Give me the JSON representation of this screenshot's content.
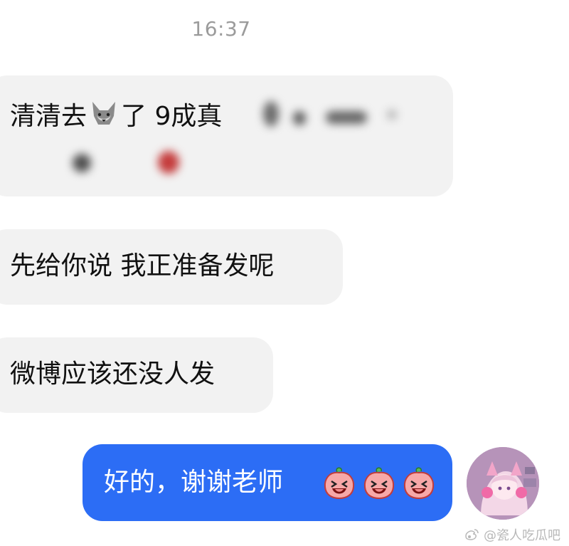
{
  "chat": {
    "timestamp": "16:37",
    "messages": [
      {
        "direction": "incoming",
        "text_before": "清清去",
        "icon": "wolf-icon",
        "text_after": "了 9成真"
      },
      {
        "direction": "incoming",
        "text": "先给你说 我正准备发呢"
      },
      {
        "direction": "incoming",
        "text": "微博应该还没人发"
      },
      {
        "direction": "outgoing",
        "text": "好的，谢谢老师",
        "emoji": [
          "peach-laugh-icon",
          "peach-laugh-icon",
          "peach-laugh-icon"
        ]
      }
    ]
  },
  "watermark": {
    "text": "@瓷人吃瓜吧"
  },
  "colors": {
    "incoming_bubble": "#f2f2f2",
    "outgoing_bubble": "#2c6df5",
    "timestamp": "#9b9b9b"
  }
}
